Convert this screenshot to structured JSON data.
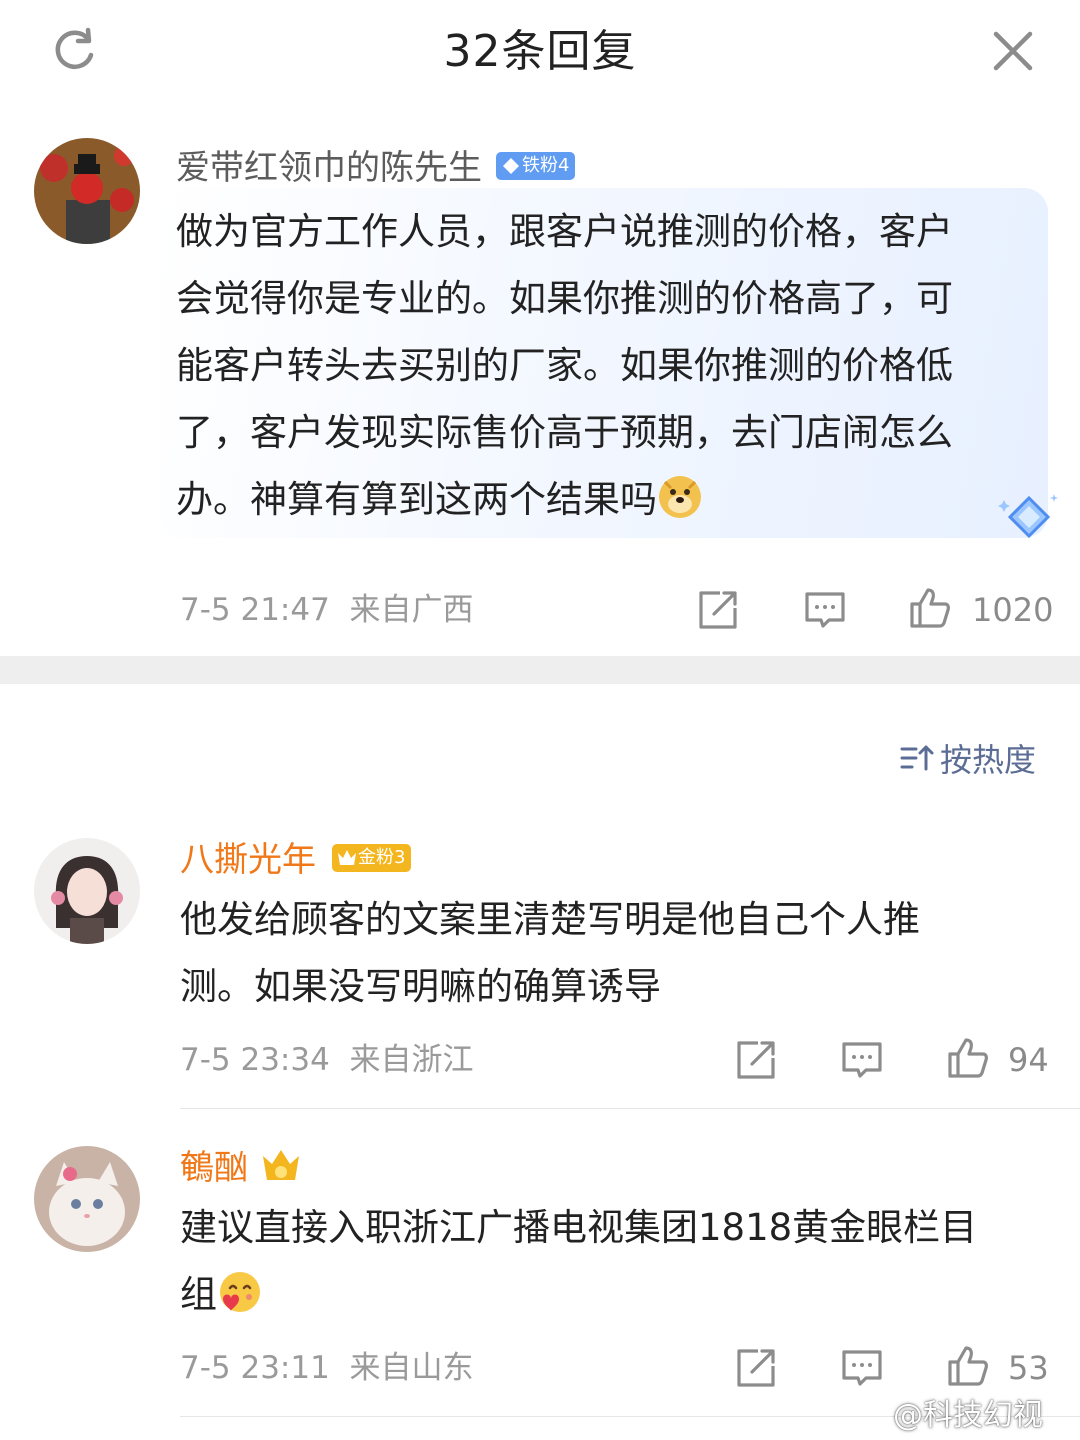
{
  "header": {
    "title": "32条回复",
    "refresh_icon": "refresh-icon",
    "close_icon": "close-icon"
  },
  "main_comment": {
    "username": "爱带红领巾的陈先生",
    "badge": "铁粉4",
    "text_lines": [
      "做为官方工作人员，跟客户说推测的价格，客户",
      "会觉得你是专业的。如果你推测的价格高了，可",
      "能客户转头去买别的厂家。如果你推测的价格低",
      "了，客户发现实际售价高于预期，去门店闹怎么",
      "办。神算有算到这两个结果吗"
    ],
    "emoji": "doge-emoji",
    "time": "7-5 21:47",
    "location": "来自广西",
    "likes": "1020"
  },
  "sort_label": "按热度",
  "replies": [
    {
      "username": "八撕光年",
      "badge": "金粉3",
      "text_lines": [
        "他发给顾客的文案里清楚写明是他自己个人推",
        "测。如果没写明嘛的确算诱导"
      ],
      "time": "7-5 23:34",
      "location": "来自浙江",
      "likes": "94"
    },
    {
      "username": "鵪酗",
      "text_lines": [
        "建议直接入职浙江广播电视集团1818黄金眼栏目",
        "组"
      ],
      "emoji": "heart-face-emoji",
      "time": "7-5 23:11",
      "location": "来自山东",
      "likes": "53"
    }
  ],
  "watermark": "@科技幻视",
  "colors": {
    "username_main": "#5c5c5c",
    "username_gold": "#f07818",
    "iron_badge": "#5f9cf2",
    "gold_badge": "#f4b61e",
    "meta_gray": "#9a9a9a",
    "sort_blue": "#5b6d94"
  }
}
